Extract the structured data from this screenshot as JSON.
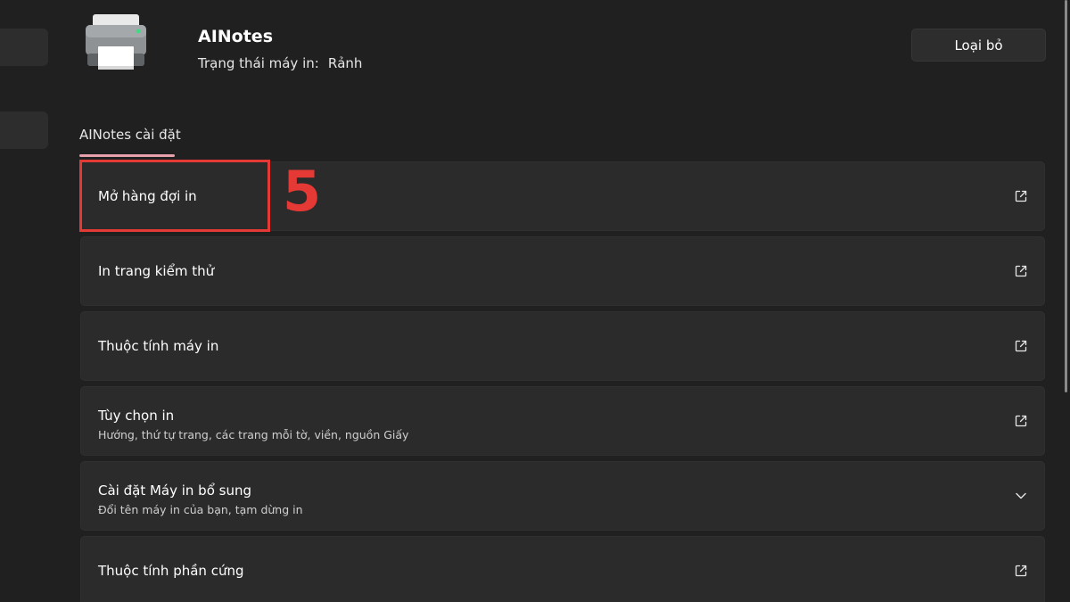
{
  "printer": {
    "name": "AINotes",
    "status_label": "Trạng thái máy in:",
    "status_value": "Rảnh"
  },
  "header": {
    "remove_label": "Loại bỏ"
  },
  "section": {
    "tab_label": "AINotes cài đặt"
  },
  "settings": [
    {
      "title": "Mở hàng đợi in",
      "description": "",
      "icon": "open-external-icon"
    },
    {
      "title": "In trang kiểm thử",
      "description": "",
      "icon": "open-external-icon"
    },
    {
      "title": "Thuộc tính máy in",
      "description": "",
      "icon": "open-external-icon"
    },
    {
      "title": "Tùy chọn in",
      "description": "Hướng, thứ tự trang, các trang mỗi tờ, viền, nguồn Giấy",
      "icon": "open-external-icon"
    },
    {
      "title": "Cài đặt Máy in bổ sung",
      "description": "Đổi tên máy in của bạn, tạm dừng in",
      "icon": "chevron-down-icon"
    },
    {
      "title": "Thuộc tính phần cứng",
      "description": "",
      "icon": "open-external-icon"
    }
  ],
  "annotation": {
    "step_number": "5",
    "color": "#e53935"
  },
  "colors": {
    "background": "#202020",
    "card": "#2b2b2b",
    "accent_underline": "#e8a0aa"
  }
}
